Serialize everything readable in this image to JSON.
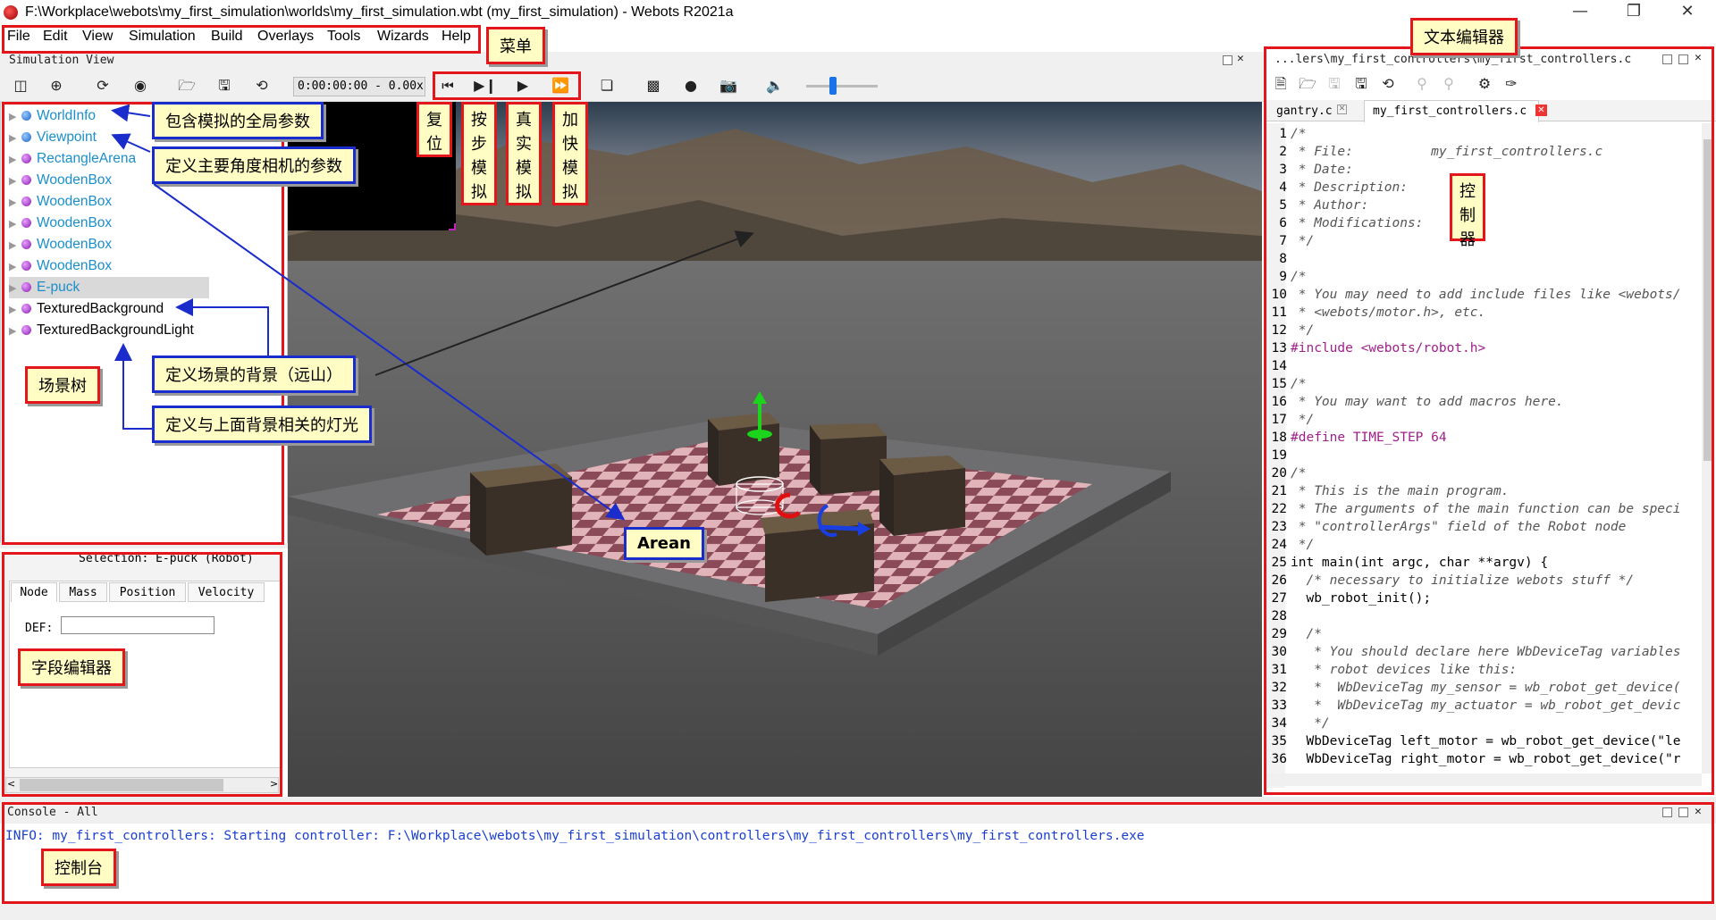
{
  "window": {
    "title": "F:\\Workplace\\webots\\my_first_simulation\\worlds\\my_first_simulation.wbt (my_first_simulation) - Webots R2021a"
  },
  "menu": [
    "File",
    "Edit",
    "View",
    "Simulation",
    "Build",
    "Overlays",
    "Tools",
    "Wizards",
    "Help"
  ],
  "simulation_view": {
    "title": "Simulation View",
    "time": "0:00:00:00 - 0.00x"
  },
  "scene_tree": {
    "nodes": [
      {
        "label": "WorldInfo",
        "color": "#1a8fc9",
        "ball": "blue"
      },
      {
        "label": "Viewpoint",
        "color": "#1a8fc9",
        "ball": "blue"
      },
      {
        "label": "RectangleArena",
        "color": "#1a8fc9",
        "ball": "pur"
      },
      {
        "label": "WoodenBox",
        "color": "#1a8fc9",
        "ball": "pur"
      },
      {
        "label": "WoodenBox",
        "color": "#1a8fc9",
        "ball": "pur"
      },
      {
        "label": "WoodenBox",
        "color": "#1a8fc9",
        "ball": "pur"
      },
      {
        "label": "WoodenBox",
        "color": "#1a8fc9",
        "ball": "pur"
      },
      {
        "label": "WoodenBox",
        "color": "#1a8fc9",
        "ball": "pur"
      },
      {
        "label": "E-puck",
        "color": "#1a8fc9",
        "ball": "pur"
      },
      {
        "label": "TexturedBackground",
        "color": "#000000",
        "ball": "pur"
      },
      {
        "label": "TexturedBackgroundLight",
        "color": "#000000",
        "ball": "pur"
      }
    ]
  },
  "field_editor": {
    "selection": "Selection: E-puck (Robot)",
    "tabs": [
      "Node",
      "Mass",
      "Position",
      "Velocity"
    ],
    "def_label": "DEF:",
    "def_value": ""
  },
  "editor": {
    "title": "...lers\\my_first_controllers\\my_first_controllers.c",
    "tabs": [
      "gantry.c",
      "my_first_controllers.c"
    ],
    "lines": [
      {
        "n": "1",
        "t": "/*",
        "c": "cm"
      },
      {
        "n": "2",
        "t": " * File:          my_first_controllers.c",
        "c": "cm"
      },
      {
        "n": "3",
        "t": " * Date:",
        "c": "cm"
      },
      {
        "n": "4",
        "t": " * Description:",
        "c": "cm"
      },
      {
        "n": "5",
        "t": " * Author:",
        "c": "cm"
      },
      {
        "n": "6",
        "t": " * Modifications:",
        "c": "cm"
      },
      {
        "n": "7",
        "t": " */",
        "c": "cm"
      },
      {
        "n": "8",
        "t": "",
        "c": ""
      },
      {
        "n": "9",
        "t": "/*",
        "c": "cm"
      },
      {
        "n": "10",
        "t": " * You may need to add include files like <webots/",
        "c": "cm"
      },
      {
        "n": "11",
        "t": " * <webots/motor.h>, etc.",
        "c": "cm"
      },
      {
        "n": "12",
        "t": " */",
        "c": "cm"
      },
      {
        "n": "13",
        "t": "#include <webots/robot.h>",
        "c": "pp"
      },
      {
        "n": "14",
        "t": "",
        "c": ""
      },
      {
        "n": "15",
        "t": "/*",
        "c": "cm"
      },
      {
        "n": "16",
        "t": " * You may want to add macros here.",
        "c": "cm"
      },
      {
        "n": "17",
        "t": " */",
        "c": "cm"
      },
      {
        "n": "18",
        "t": "#define TIME_STEP 64",
        "c": "pp"
      },
      {
        "n": "19",
        "t": "",
        "c": ""
      },
      {
        "n": "20",
        "t": "/*",
        "c": "cm"
      },
      {
        "n": "21",
        "t": " * This is the main program.",
        "c": "cm"
      },
      {
        "n": "22",
        "t": " * The arguments of the main function can be speci",
        "c": "cm"
      },
      {
        "n": "23",
        "t": " * \"controllerArgs\" field of the Robot node",
        "c": "cm"
      },
      {
        "n": "24",
        "t": " */",
        "c": "cm"
      },
      {
        "n": "25",
        "t": "int main(int argc, char **argv) {",
        "c": "fn"
      },
      {
        "n": "26",
        "t": "  /* necessary to initialize webots stuff */",
        "c": "cm"
      },
      {
        "n": "27",
        "t": "  wb_robot_init();",
        "c": "fn"
      },
      {
        "n": "28",
        "t": "",
        "c": ""
      },
      {
        "n": "29",
        "t": "  /*",
        "c": "cm"
      },
      {
        "n": "30",
        "t": "   * You should declare here WbDeviceTag variables",
        "c": "cm"
      },
      {
        "n": "31",
        "t": "   * robot devices like this:",
        "c": "cm"
      },
      {
        "n": "32",
        "t": "   *  WbDeviceTag my_sensor = wb_robot_get_device(",
        "c": "cm"
      },
      {
        "n": "33",
        "t": "   *  WbDeviceTag my_actuator = wb_robot_get_devic",
        "c": "cm"
      },
      {
        "n": "34",
        "t": "   */",
        "c": "cm"
      },
      {
        "n": "35",
        "t": "  WbDeviceTag left_motor = wb_robot_get_device(\"le",
        "c": "fn"
      },
      {
        "n": "36",
        "t": "  WbDeviceTag right_motor = wb_robot_get_device(\"r",
        "c": "fn"
      }
    ]
  },
  "console": {
    "title": "Console - All",
    "message": "INFO: my_first_controllers: Starting controller: F:\\Workplace\\webots\\my_first_simulation\\controllers\\my_first_controllers\\my_first_controllers.exe"
  },
  "annotations": {
    "menu": "菜单",
    "text_editor": "文本编辑器",
    "worldinfo": "包含模拟的全局参数",
    "viewpoint": "定义主要角度相机的参数",
    "background": "定义场景的背景（远山）",
    "light": "定义与上面背景相关的灯光",
    "scene_tree": "场景树",
    "field_editor": "字段编辑器",
    "arena": "Arean",
    "console": "控制台",
    "reset": "复位",
    "step": "按步模拟",
    "realtime": "真实模拟",
    "fast": "加快模拟",
    "controller": "控制器"
  }
}
